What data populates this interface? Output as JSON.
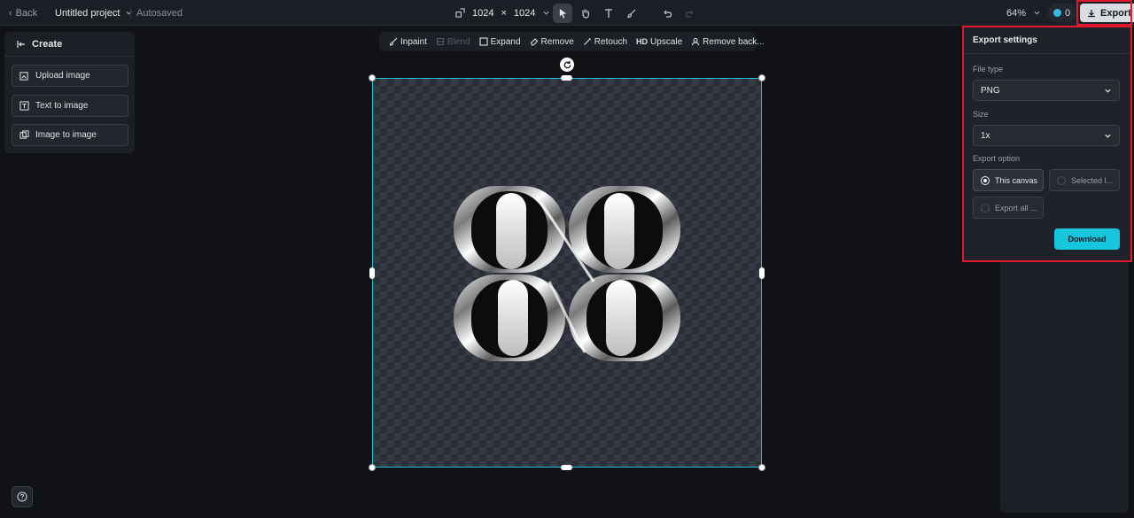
{
  "topbar": {
    "back_label": "Back",
    "project_name": "Untitled project",
    "autosave_status": "Autosaved",
    "canvas_width": "1024",
    "times": "×",
    "canvas_height": "1024",
    "zoom_level": "64%",
    "credits_count": "0",
    "export_label": "Export"
  },
  "left_panel": {
    "title": "Create",
    "items": [
      {
        "label": "Upload image",
        "icon": "upload-image-icon"
      },
      {
        "label": "Text to image",
        "icon": "text-to-image-icon"
      },
      {
        "label": "Image to image",
        "icon": "image-to-image-icon"
      }
    ]
  },
  "edit_toolbar": {
    "items": [
      {
        "label": "Inpaint",
        "icon": "brush-icon",
        "disabled": false
      },
      {
        "label": "Blend",
        "icon": "blend-icon",
        "disabled": true
      },
      {
        "label": "Expand",
        "icon": "expand-icon",
        "disabled": false
      },
      {
        "label": "Remove",
        "icon": "eraser-icon",
        "disabled": false
      },
      {
        "label": "Retouch",
        "icon": "wand-icon",
        "disabled": false
      },
      {
        "label": "Upscale",
        "icon": "hd-icon",
        "disabled": false
      },
      {
        "label": "Remove back...",
        "icon": "remove-background-icon",
        "disabled": false
      }
    ],
    "upscale_badge": "HD"
  },
  "export_panel": {
    "title": "Export settings",
    "file_type_label": "File type",
    "file_type_value": "PNG",
    "size_label": "Size",
    "size_value": "1x",
    "export_option_label": "Export option",
    "options": [
      {
        "label": "This canvas",
        "selected": true
      },
      {
        "label": "Selected l...",
        "selected": false
      },
      {
        "label": "Export all ...",
        "selected": false
      }
    ],
    "download_label": "Download"
  },
  "colors": {
    "accent": "#16c6dc",
    "selection": "#22c4d4",
    "highlight": "#e0182d",
    "background": "#101216"
  }
}
